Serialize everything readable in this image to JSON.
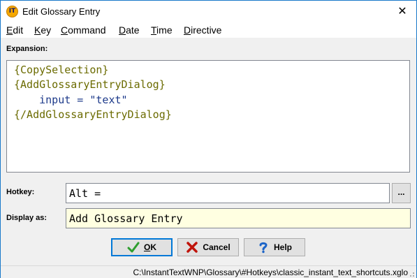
{
  "window": {
    "title": "Edit Glossary Entry",
    "app_icon_text": "IT",
    "close_glyph": "✕"
  },
  "menu": {
    "items": [
      {
        "underline": "E",
        "rest": "dit"
      },
      {
        "underline": "K",
        "rest": "ey"
      },
      {
        "underline": "C",
        "rest": "ommand"
      },
      {
        "underline": "D",
        "rest": "ate"
      },
      {
        "underline": "T",
        "rest": "ime"
      },
      {
        "underline": "D",
        "rest": "irective"
      }
    ]
  },
  "expansion": {
    "label": "Expansion:",
    "lines": [
      "{CopySelection}",
      "{AddGlossaryEntryDialog}",
      "    input = \"text\"",
      "{/AddGlossaryEntryDialog}"
    ]
  },
  "hotkey": {
    "label": "Hotkey:",
    "value": "Alt =",
    "browse_label": "..."
  },
  "display_as": {
    "label": "Display as:",
    "value": "Add Glossary Entry"
  },
  "buttons": {
    "ok_underline": "O",
    "ok_rest": "K",
    "cancel": "Cancel",
    "help": "Help"
  },
  "status": {
    "path": "C:\\InstantTextWNP\\Glossary\\#Hotkeys\\classic_instant_text_shortcuts.xglo"
  },
  "colors": {
    "accent_border": "#1979ca",
    "expansion_text": "#6b6b00",
    "expansion_inner_text": "#1d3a8a",
    "display_bg": "#ffffe1",
    "ok_check": "#2e9e2e",
    "cancel_x": "#c0140c",
    "help_question": "#1c64c8"
  },
  "icons": {
    "app": "instanttext-logo-icon",
    "close": "close-icon",
    "ok": "checkmark-icon",
    "cancel": "red-x-icon",
    "help": "question-mark-icon",
    "grip": "resize-grip-icon"
  }
}
